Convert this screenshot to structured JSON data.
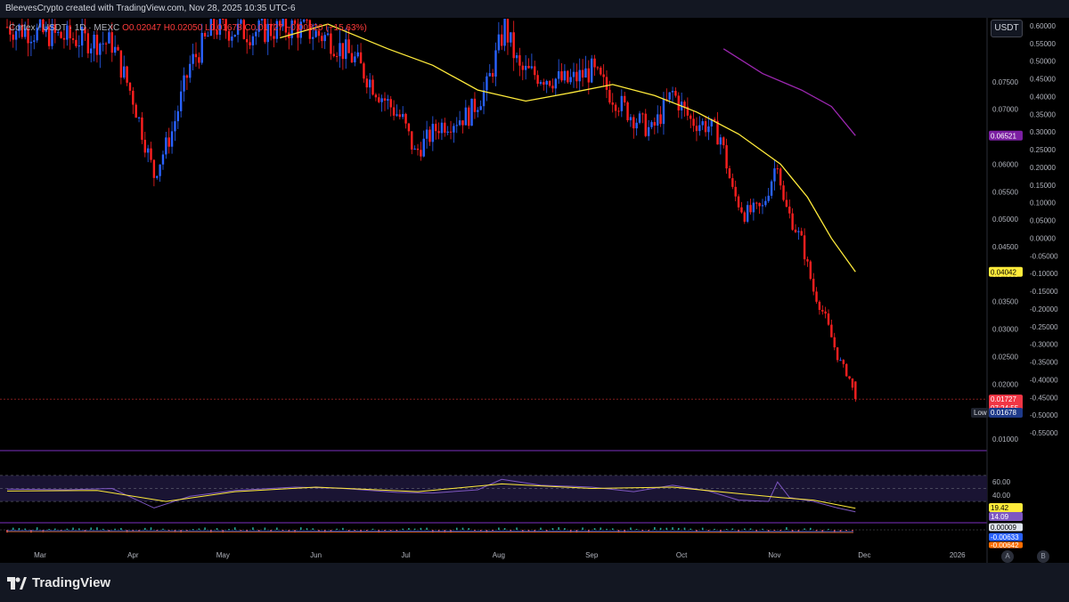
{
  "header": {
    "attribution": "BleevesCrypto created with TradingView.com, Nov 28, 2025 10:35 UTC-6"
  },
  "legend": {
    "symbol": "Cortex / USDT · 1D · MEXC",
    "open": "O0.02047",
    "high": "H0.02050",
    "low": "L0.01678",
    "close": "C0.01727",
    "change": "−0.00320 (−15.63%)"
  },
  "currency_button": "USDT",
  "price_axis_left": [
    "0.07500",
    "0.07000",
    "0.06500",
    "0.06000",
    "0.05500",
    "0.05000",
    "0.04500",
    "0.04000",
    "0.03500",
    "0.03000",
    "0.02500",
    "0.02000",
    "0.01500",
    "0.01000"
  ],
  "price_axis_right": [
    "0.60000",
    "0.55000",
    "0.50000",
    "0.45000",
    "0.40000",
    "0.35000",
    "0.30000",
    "0.25000",
    "0.20000",
    "0.15000",
    "0.10000",
    "0.05000",
    "0.00000",
    "-0.05000",
    "-0.10000",
    "-0.15000",
    "-0.20000",
    "-0.25000",
    "-0.30000",
    "-0.35000",
    "-0.40000",
    "-0.45000",
    "-0.50000",
    "-0.55000"
  ],
  "badges": {
    "ma_long": "0.06521",
    "ma_short": "0.04042",
    "last_price": "0.01727",
    "countdown": "07:24:55",
    "low_label": "Low",
    "low_value": "0.01678",
    "rsi_ma": "19.42",
    "rsi": "14.09",
    "macd_1": "0.00009",
    "macd_2": "-0.00633",
    "macd_3": "-0.00642"
  },
  "rsi_axis": [
    "60.00",
    "40.00"
  ],
  "time_axis": [
    "Mar",
    "Apr",
    "May",
    "Jun",
    "Jul",
    "Aug",
    "Sep",
    "Oct",
    "Nov",
    "Dec",
    "2026"
  ],
  "footer": {
    "logo_text": "TradingView",
    "btn_a": "A",
    "btn_b": "B"
  },
  "colors": {
    "up": "#2962ff",
    "down": "#ff1f1f",
    "ma_short": "#ffeb3b",
    "ma_long": "#9c27b0",
    "rsi": "#7e57c2",
    "rsi_ma": "#ffeb3b",
    "background": "#000000"
  },
  "chart_data": {
    "type": "candlestick",
    "title": "Cortex / USDT · 1D · MEXC",
    "xlabel": "",
    "ylabel": "",
    "ylim": [
      0.01,
      0.08
    ],
    "x_range": [
      "2025-02-18",
      "2026-01-10"
    ],
    "price_path": [
      [
        "2025-02-18",
        0.085
      ],
      [
        "2025-03-10",
        0.083
      ],
      [
        "2025-03-25",
        0.082
      ],
      [
        "2025-04-01",
        0.072
      ],
      [
        "2025-04-08",
        0.058
      ],
      [
        "2025-04-14",
        0.066
      ],
      [
        "2025-04-20",
        0.078
      ],
      [
        "2025-04-28",
        0.085
      ],
      [
        "2025-05-10",
        0.084
      ],
      [
        "2025-05-25",
        0.085
      ],
      [
        "2025-06-05",
        0.083
      ],
      [
        "2025-06-14",
        0.079
      ],
      [
        "2025-06-22",
        0.073
      ],
      [
        "2025-06-30",
        0.068
      ],
      [
        "2025-07-04",
        0.062
      ],
      [
        "2025-07-12",
        0.067
      ],
      [
        "2025-07-22",
        0.069
      ],
      [
        "2025-07-28",
        0.074
      ],
      [
        "2025-08-03",
        0.085
      ],
      [
        "2025-08-08",
        0.077
      ],
      [
        "2025-08-16",
        0.076
      ],
      [
        "2025-08-24",
        0.075
      ],
      [
        "2025-09-01",
        0.077
      ],
      [
        "2025-09-07",
        0.073
      ],
      [
        "2025-09-14",
        0.069
      ],
      [
        "2025-09-21",
        0.066
      ],
      [
        "2025-09-28",
        0.073
      ],
      [
        "2025-10-04",
        0.068
      ],
      [
        "2025-10-10",
        0.067
      ],
      [
        "2025-10-14",
        0.065
      ],
      [
        "2025-10-18",
        0.055
      ],
      [
        "2025-10-22",
        0.051
      ],
      [
        "2025-10-28",
        0.052
      ],
      [
        "2025-11-02",
        0.061
      ],
      [
        "2025-11-04",
        0.053
      ],
      [
        "2025-11-10",
        0.046
      ],
      [
        "2025-11-14",
        0.037
      ],
      [
        "2025-11-18",
        0.032
      ],
      [
        "2025-11-22",
        0.025
      ],
      [
        "2025-11-26",
        0.021
      ],
      [
        "2025-11-28",
        0.01727
      ]
    ],
    "ma_short": [
      [
        "2025-05-20",
        0.083
      ],
      [
        "2025-06-05",
        0.0855
      ],
      [
        "2025-06-25",
        0.081
      ],
      [
        "2025-07-10",
        0.078
      ],
      [
        "2025-07-25",
        0.0735
      ],
      [
        "2025-08-10",
        0.0715
      ],
      [
        "2025-08-25",
        0.073
      ],
      [
        "2025-09-08",
        0.0745
      ],
      [
        "2025-09-22",
        0.0725
      ],
      [
        "2025-10-06",
        0.0695
      ],
      [
        "2025-10-20",
        0.0655
      ],
      [
        "2025-11-03",
        0.06
      ],
      [
        "2025-11-12",
        0.054
      ],
      [
        "2025-11-20",
        0.0465
      ],
      [
        "2025-11-28",
        0.04042
      ]
    ],
    "ma_long": [
      [
        "2025-10-15",
        0.081
      ],
      [
        "2025-10-28",
        0.0765
      ],
      [
        "2025-11-10",
        0.0735
      ],
      [
        "2025-11-20",
        0.0705
      ],
      [
        "2025-11-28",
        0.06521
      ]
    ],
    "last": {
      "open": 0.02047,
      "high": 0.0205,
      "low": 0.01678,
      "close": 0.01727
    },
    "rsi": {
      "series": [
        [
          "2025-02-18",
          49
        ],
        [
          "2025-03-10",
          48
        ],
        [
          "2025-03-25",
          50
        ],
        [
          "2025-04-08",
          20
        ],
        [
          "2025-04-20",
          38
        ],
        [
          "2025-05-05",
          47
        ],
        [
          "2025-05-25",
          52
        ],
        [
          "2025-06-10",
          50
        ],
        [
          "2025-06-28",
          44
        ],
        [
          "2025-07-10",
          43
        ],
        [
          "2025-07-25",
          48
        ],
        [
          "2025-08-02",
          64
        ],
        [
          "2025-08-15",
          55
        ],
        [
          "2025-09-01",
          52
        ],
        [
          "2025-09-15",
          45
        ],
        [
          "2025-09-28",
          55
        ],
        [
          "2025-10-10",
          46
        ],
        [
          "2025-10-20",
          32
        ],
        [
          "2025-10-30",
          30
        ],
        [
          "2025-11-02",
          60
        ],
        [
          "2025-11-06",
          36
        ],
        [
          "2025-11-14",
          30
        ],
        [
          "2025-11-22",
          20
        ],
        [
          "2025-11-28",
          14.09
        ]
      ],
      "ma": [
        [
          "2025-02-18",
          46
        ],
        [
          "2025-03-20",
          47
        ],
        [
          "2025-04-12",
          30
        ],
        [
          "2025-05-05",
          45
        ],
        [
          "2025-06-01",
          52
        ],
        [
          "2025-07-05",
          45
        ],
        [
          "2025-08-02",
          57
        ],
        [
          "2025-09-01",
          50
        ],
        [
          "2025-09-28",
          52
        ],
        [
          "2025-10-20",
          42
        ],
        [
          "2025-11-03",
          36
        ],
        [
          "2025-11-14",
          32
        ],
        [
          "2025-11-28",
          19.42
        ]
      ],
      "levels": [
        70,
        50,
        30
      ]
    }
  }
}
